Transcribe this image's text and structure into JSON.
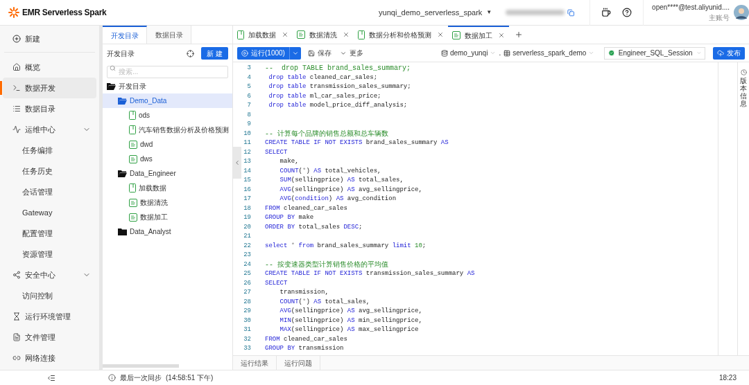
{
  "header": {
    "brand": "EMR Serverless Spark",
    "workspace": "yunqi_demo_serverless_spark",
    "caret": "▼",
    "account": "open****@test.aliyunid....",
    "account_type": "主账号"
  },
  "sidebar": {
    "new": "新建",
    "items": [
      {
        "label": "概览",
        "selected": false
      },
      {
        "label": "数据开发",
        "selected": true
      },
      {
        "label": "数据目录",
        "selected": false
      },
      {
        "label": "运维中心",
        "selected": false,
        "expanded": true,
        "children": [
          {
            "label": "任务编排",
            "selected": false
          },
          {
            "label": "任务历史",
            "selected": false
          },
          {
            "label": "会话管理",
            "selected": false
          },
          {
            "label": "Gateway",
            "selected": false
          },
          {
            "label": "配置管理",
            "selected": false
          },
          {
            "label": "资源管理",
            "selected": false
          }
        ]
      },
      {
        "label": "安全中心",
        "selected": false,
        "expanded": true,
        "children": [
          {
            "label": "访问控制",
            "selected": false
          }
        ]
      },
      {
        "label": "运行环境管理",
        "selected": false
      },
      {
        "label": "文件管理",
        "selected": false
      },
      {
        "label": "网络连接",
        "selected": false
      }
    ]
  },
  "explorer": {
    "tabs": [
      {
        "label": "开发目录",
        "selected": true
      },
      {
        "label": "数据目录",
        "selected": false
      }
    ],
    "title": "开发目录",
    "new_button": "新 建",
    "search_placeholder": "搜索...",
    "tree": [
      {
        "kind": "folder",
        "label": "开发目录",
        "expanded": true,
        "selected": false,
        "children": [
          {
            "kind": "folder",
            "label": "Demo_Data",
            "expanded": true,
            "selected": true,
            "children": [
              {
                "kind": "notebook",
                "label": "ods",
                "selected": false
              },
              {
                "kind": "notebook",
                "label": "汽车销售数据分析及价格预测",
                "selected": false
              },
              {
                "kind": "sql",
                "label": "dwd",
                "selected": false
              },
              {
                "kind": "sql",
                "label": "dws",
                "selected": false
              }
            ]
          },
          {
            "kind": "folder",
            "label": "Data_Engineer",
            "expanded": true,
            "selected": false,
            "children": [
              {
                "kind": "notebook",
                "label": "加载数据",
                "selected": false
              },
              {
                "kind": "sql",
                "label": "数据清洗",
                "selected": false
              },
              {
                "kind": "sql",
                "label": "数据加工",
                "selected": false
              }
            ]
          },
          {
            "kind": "folder",
            "label": "Data_Analyst",
            "expanded": false,
            "selected": false
          }
        ]
      }
    ]
  },
  "editor_tabs": [
    {
      "kind": "notebook",
      "label": "加载数据",
      "selected": false
    },
    {
      "kind": "sql",
      "label": "数据清洗",
      "selected": false
    },
    {
      "kind": "notebook",
      "label": "数据分析和价格预测",
      "selected": false
    },
    {
      "kind": "sql",
      "label": "数据加工",
      "selected": true
    }
  ],
  "toolbar": {
    "run": "运行(1000)",
    "save": "保存",
    "more": "更多",
    "catalog": "demo_yunqi",
    "separator": ".",
    "database": "serverless_spark_demo",
    "session": "Engineer_SQL_Session",
    "publish": "发布"
  },
  "code": [
    {
      "n": "3",
      "tokens": [
        {
          "kind": "comment",
          "text": "--  drop TABLE brand_sales_summary;"
        }
      ]
    },
    {
      "n": "4",
      "tokens": [
        {
          "kind": "kw",
          "text": " drop table"
        },
        {
          "kind": "text",
          "text": " cleaned_car_sales;"
        }
      ]
    },
    {
      "n": "5",
      "tokens": [
        {
          "kind": "kw",
          "text": " drop table"
        },
        {
          "kind": "text",
          "text": " transmission_sales_summary;"
        }
      ]
    },
    {
      "n": "6",
      "tokens": [
        {
          "kind": "kw",
          "text": " drop table"
        },
        {
          "kind": "text",
          "text": " ml_car_sales_price;"
        }
      ]
    },
    {
      "n": "7",
      "tokens": [
        {
          "kind": "kw",
          "text": " drop table"
        },
        {
          "kind": "text",
          "text": " model_price_diff_analysis;"
        }
      ]
    },
    {
      "n": "8"
    },
    {
      "n": "9"
    },
    {
      "n": "10",
      "tokens": [
        {
          "kind": "comment",
          "text": "-- 计算每个品牌的销售总额和总车辆数"
        }
      ]
    },
    {
      "n": "11",
      "tokens": [
        {
          "kind": "kw",
          "text": "CREATE TABLE IF NOT EXISTS"
        },
        {
          "kind": "text",
          "text": " brand_sales_summary "
        },
        {
          "kind": "kw",
          "text": "AS"
        }
      ]
    },
    {
      "n": "12",
      "tokens": [
        {
          "kind": "kw",
          "text": "SELECT"
        }
      ]
    },
    {
      "n": "13",
      "tokens": [
        {
          "kind": "text",
          "text": "    make,"
        }
      ]
    },
    {
      "n": "14",
      "tokens": [
        {
          "kind": "kw",
          "text": "    COUNT"
        },
        {
          "kind": "text",
          "text": "("
        },
        {
          "kind": "op",
          "text": "*"
        },
        {
          "kind": "text",
          "text": ") "
        },
        {
          "kind": "kw",
          "text": "AS"
        },
        {
          "kind": "text",
          "text": " total_vehicles,"
        }
      ]
    },
    {
      "n": "15",
      "tokens": [
        {
          "kind": "kw",
          "text": "    SUM"
        },
        {
          "kind": "text",
          "text": "(sellingprice) "
        },
        {
          "kind": "kw",
          "text": "AS"
        },
        {
          "kind": "text",
          "text": " total_sales,"
        }
      ]
    },
    {
      "n": "16",
      "tokens": [
        {
          "kind": "kw",
          "text": "    AVG"
        },
        {
          "kind": "text",
          "text": "(sellingprice) "
        },
        {
          "kind": "kw",
          "text": "AS"
        },
        {
          "kind": "text",
          "text": " avg_sellingprice,"
        }
      ]
    },
    {
      "n": "17",
      "tokens": [
        {
          "kind": "kw",
          "text": "    AVG"
        },
        {
          "kind": "text",
          "text": "("
        },
        {
          "kind": "kw",
          "text": "condition"
        },
        {
          "kind": "text",
          "text": ") "
        },
        {
          "kind": "kw",
          "text": "AS"
        },
        {
          "kind": "text",
          "text": " avg_condition"
        }
      ]
    },
    {
      "n": "18",
      "tokens": [
        {
          "kind": "kw",
          "text": "FROM"
        },
        {
          "kind": "text",
          "text": " cleaned_car_sales"
        }
      ]
    },
    {
      "n": "19",
      "tokens": [
        {
          "kind": "kw",
          "text": "GROUP BY"
        },
        {
          "kind": "text",
          "text": " make"
        }
      ]
    },
    {
      "n": "20",
      "tokens": [
        {
          "kind": "kw",
          "text": "ORDER BY"
        },
        {
          "kind": "text",
          "text": " total_sales "
        },
        {
          "kind": "kw",
          "text": "DESC"
        },
        {
          "kind": "text",
          "text": ";"
        }
      ]
    },
    {
      "n": "21"
    },
    {
      "n": "22",
      "tokens": [
        {
          "kind": "kw",
          "text": "select"
        },
        {
          "kind": "op",
          "text": " * "
        },
        {
          "kind": "kw",
          "text": "from"
        },
        {
          "kind": "text",
          "text": " brand_sales_summary "
        },
        {
          "kind": "kw",
          "text": "limit"
        },
        {
          "kind": "num",
          "text": " 10"
        },
        {
          "kind": "text",
          "text": ";"
        }
      ]
    },
    {
      "n": "23"
    },
    {
      "n": "24",
      "tokens": [
        {
          "kind": "comment",
          "text": "-- 按变速器类型计算销售价格的平均值"
        }
      ]
    },
    {
      "n": "25",
      "tokens": [
        {
          "kind": "kw",
          "text": "CREATE TABLE IF NOT EXISTS"
        },
        {
          "kind": "text",
          "text": " transmission_sales_summary "
        },
        {
          "kind": "kw",
          "text": "AS"
        }
      ]
    },
    {
      "n": "26",
      "tokens": [
        {
          "kind": "kw",
          "text": "SELECT"
        }
      ]
    },
    {
      "n": "27",
      "tokens": [
        {
          "kind": "text",
          "text": "    transmission,"
        }
      ]
    },
    {
      "n": "28",
      "tokens": [
        {
          "kind": "kw",
          "text": "    COUNT"
        },
        {
          "kind": "text",
          "text": "("
        },
        {
          "kind": "op",
          "text": "*"
        },
        {
          "kind": "text",
          "text": ") "
        },
        {
          "kind": "kw",
          "text": "AS"
        },
        {
          "kind": "text",
          "text": " total_sales,"
        }
      ]
    },
    {
      "n": "29",
      "tokens": [
        {
          "kind": "kw",
          "text": "    AVG"
        },
        {
          "kind": "text",
          "text": "(sellingprice) "
        },
        {
          "kind": "kw",
          "text": "AS"
        },
        {
          "kind": "text",
          "text": " avg_sellingprice,"
        }
      ]
    },
    {
      "n": "30",
      "tokens": [
        {
          "kind": "kw",
          "text": "    MIN"
        },
        {
          "kind": "text",
          "text": "(sellingprice) "
        },
        {
          "kind": "kw",
          "text": "AS"
        },
        {
          "kind": "text",
          "text": " min_sellingprice,"
        }
      ]
    },
    {
      "n": "31",
      "tokens": [
        {
          "kind": "kw",
          "text": "    MAX"
        },
        {
          "kind": "text",
          "text": "(sellingprice) "
        },
        {
          "kind": "kw",
          "text": "AS"
        },
        {
          "kind": "text",
          "text": " max_sellingprice"
        }
      ]
    },
    {
      "n": "32",
      "tokens": [
        {
          "kind": "kw",
          "text": "FROM"
        },
        {
          "kind": "text",
          "text": " cleaned_car_sales"
        }
      ]
    },
    {
      "n": "33",
      "tokens": [
        {
          "kind": "kw",
          "text": "GROUP BY"
        },
        {
          "kind": "text",
          "text": " transmission"
        }
      ]
    }
  ],
  "version_panel": "版本信息",
  "result_tabs": [
    {
      "label": "运行结果",
      "selected": false
    },
    {
      "label": "运行问题",
      "selected": false
    }
  ],
  "status": {
    "sync": "最后一次同步",
    "sync_time": "(14:58:51 下午)",
    "clock": "18:23"
  }
}
